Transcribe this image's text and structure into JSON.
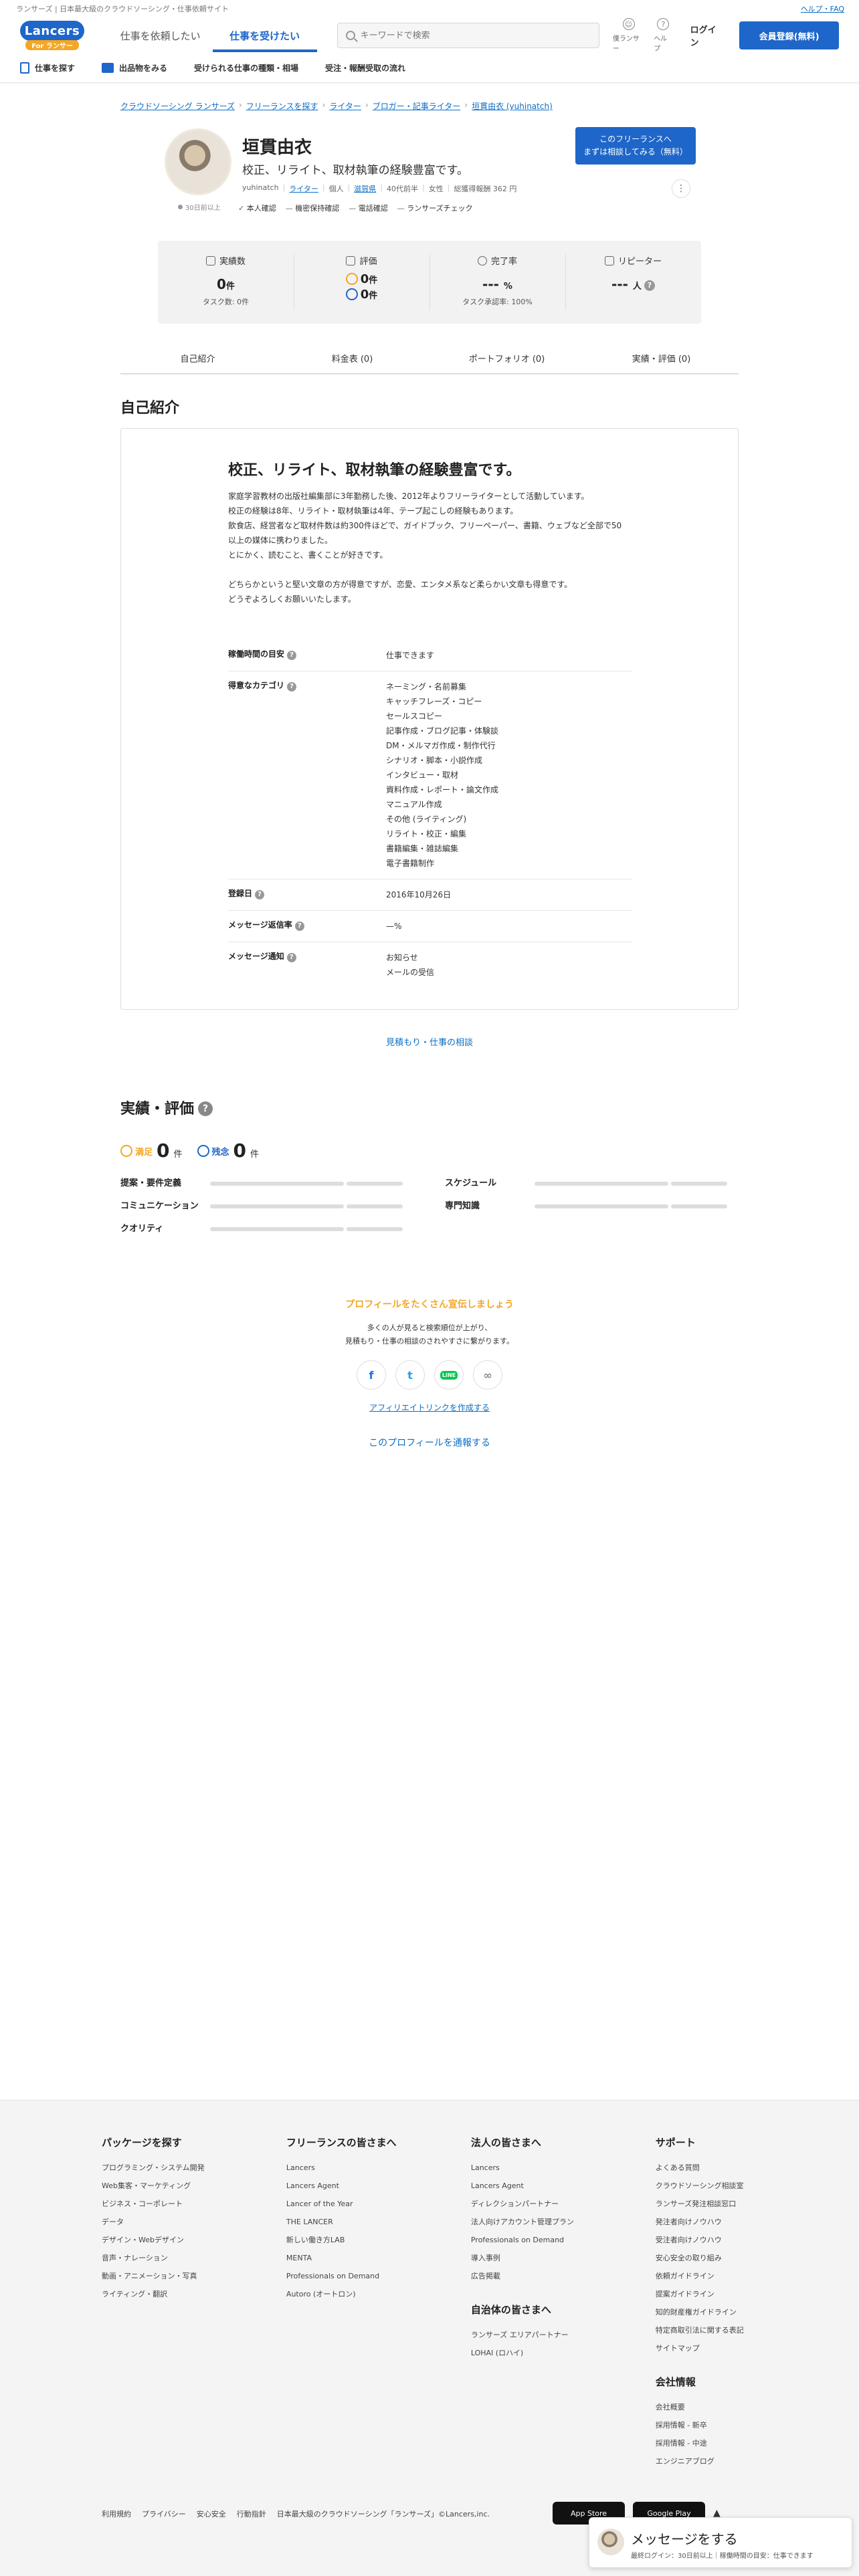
{
  "topstrip": {
    "tagline": "ランサーズ | 日本最大級のクラウドソーシング・仕事依頼サイト",
    "help": "ヘルプ・FAQ"
  },
  "header": {
    "logo_main": "Lancers",
    "logo_sub": "For ランサー",
    "tab_buyer": "仕事を依頼したい",
    "tab_seller": "仕事を受けたい",
    "search_placeholder": "キーワードで検索",
    "icon_lancer": "僕ランサー",
    "icon_help": "ヘルプ",
    "login": "ログイン",
    "register": "会員登録(無料)"
  },
  "subnav": {
    "find_work": "仕事を探す",
    "items_list": "出品物をみる",
    "categories": "受けられる仕事の種類・相場",
    "flow": "受注・報酬受取の流れ"
  },
  "breadcrumb": [
    "クラウドソーシング ランサーズ",
    "フリーランスを探す",
    "ライター",
    "ブロガー・記事ライター",
    "垣貫由衣 (yuhinatch)"
  ],
  "profile": {
    "name": "垣貫由衣",
    "catch": "校正、リライト、取材執筆の経験豊富です。",
    "meta": [
      "yuhinatch",
      "ライター",
      "個人",
      "滋賀県",
      "40代前半",
      "女性",
      "総獲得報酬 362 円"
    ],
    "online": "30日前以上",
    "checks": {
      "identity": "本人確認",
      "privacy": "機密保持確認",
      "phone": "電話確認",
      "lancer_check": "ランサーズチェック"
    },
    "hire_line1": "このフリーランスへ",
    "hire_line2": "まずは相談してみる（無料）",
    "more": "⋮"
  },
  "stats": {
    "results_label": "実績数",
    "results_value": "0",
    "results_unit": "件",
    "results_sub": "タスク数: 0件",
    "rating_label": "評価",
    "rating_good": "0",
    "rating_bad": "0",
    "rating_unit": "件",
    "completion_label": "完了率",
    "completion_value": "---",
    "completion_unit": "%",
    "completion_sub": "タスク承認率: 100%",
    "repeat_label": "リピーター",
    "repeat_value": "---",
    "repeat_unit": "人"
  },
  "tabs": [
    "自己紹介",
    "料金表 (0)",
    "ポートフォリオ (0)",
    "実績・評価 (0)"
  ],
  "intro": {
    "heading": "自己紹介",
    "catch": "校正、リライト、取材執筆の経験豊富です。",
    "text": "家庭学習教材の出版社編集部に3年勤務した後、2012年よりフリーライターとして活動しています。\n校正の経験は8年、リライト・取材執筆は4年、テープ起こしの経験もあります。\n飲食店、経営者など取材件数は約300件ほどで、ガイドブック、フリーペーパー、書籍、ウェブなど全部で50以上の媒体に携わりました。\nとにかく、読むこと、書くことが好きです。\n\nどちらかというと堅い文章の方が得意ですが、恋愛、エンタメ系など柔らかい文章も得意です。\nどうぞよろしくお願いいたします。",
    "rows": [
      {
        "label": "稼働時間の目安",
        "value": "仕事できます"
      },
      {
        "label": "得意なカテゴリ",
        "value": "ネーミング・名前募集\nキャッチフレーズ・コピー\nセールスコピー\n記事作成・ブログ記事・体験談\nDM・メルマガ作成・制作代行\nシナリオ・脚本・小説作成\nインタビュー・取材\n資料作成・レポート・論文作成\nマニュアル作成\nその他 (ライティング)\nリライト・校正・編集\n書籍編集・雑誌編集\n電子書籍制作"
      },
      {
        "label": "登録日",
        "value": "2016年10月26日"
      },
      {
        "label": "メッセージ返信率",
        "value": "—%"
      },
      {
        "label": "メッセージ通知",
        "value": "お知らせ\nメールの受信"
      }
    ],
    "consult": "見積もり・仕事の相談"
  },
  "reviews": {
    "heading": "実績・評価",
    "good_label": "満足",
    "good_count": "0",
    "bad_label": "残念",
    "bad_count": "0",
    "unit": "件",
    "items": [
      "提案・要件定義",
      "スケジュール",
      "コミュニケーション",
      "専門知識",
      "クオリティ"
    ]
  },
  "promo": {
    "title": "プロフィールをたくさん宣伝しましょう",
    "line1": "多くの人が見ると検索順位が上がり、",
    "line2": "見積もり・仕事の相談のされやすさに繋がります。",
    "affiliate": "アフィリエイトリンクを作成する",
    "report": "このプロフィールを通報する"
  },
  "footer": {
    "col1": {
      "title": "パッケージを探す",
      "links": [
        "プログラミング・システム開発",
        "Web集客・マーケティング",
        "ビジネス・コーポレート",
        "データ",
        "デザイン・Webデザイン",
        "音声・ナレーション",
        "動画・アニメーション・写真",
        "ライティング・翻訳"
      ]
    },
    "col2": {
      "title": "フリーランスの皆さまへ",
      "links": [
        "Lancers",
        "Lancers Agent",
        "Lancer of the Year",
        "THE LANCER",
        "新しい働き方LAB",
        "MENTA",
        "Professionals on Demand",
        "Autoro (オートロン)"
      ]
    },
    "col3": {
      "title": "法人の皆さまへ",
      "links": [
        "Lancers",
        "Lancers Agent",
        "ディレクションパートナー",
        "法人向けアカウント管理プラン",
        "Professionals on Demand",
        "導入事例",
        "広告掲載"
      ],
      "title2": "自治体の皆さまへ",
      "links2": [
        "ランサーズ エリアパートナー",
        "LOHAI (ロハイ)"
      ]
    },
    "col4": {
      "title": "サポート",
      "links": [
        "よくある質問",
        "クラウドソーシング相談室",
        "ランサーズ発注相談窓口",
        "発注者向けノウハウ",
        "受注者向けノウハウ",
        "安心安全の取り組み",
        "依頼ガイドライン",
        "提案ガイドライン",
        "知的財産権ガイドライン",
        "特定商取引法に関する表記",
        "サイトマップ"
      ],
      "title2": "会社情報",
      "links2": [
        "会社概要",
        "採用情報 - 新卒",
        "採用情報 - 中途",
        "エンジニアブログ"
      ]
    },
    "bottom": [
      "利用規約",
      "プライバシー",
      "安心安全",
      "行動指針",
      "日本最大級のクラウドソーシング「ランサーズ」©Lancers,inc."
    ],
    "appstore": "App Store",
    "googleplay": "Google Play",
    "totop": "▲"
  },
  "message": {
    "title": "メッセージをする",
    "sub": "最終ログイン：30日前以上｜稼働時間の目安：仕事できます"
  }
}
